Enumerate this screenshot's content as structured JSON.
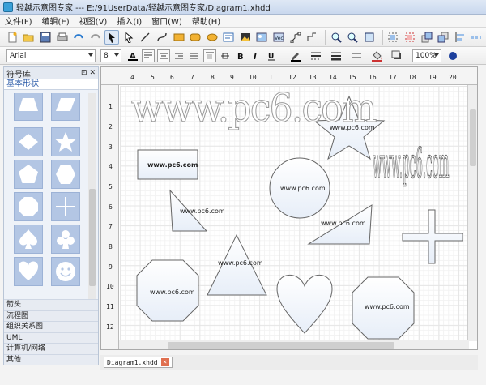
{
  "window": {
    "title": "轻越示意图专家 --- E:/91UserData/轻越示意图专家/Diagram1.xhdd"
  },
  "menu": [
    "文件(F)",
    "编辑(E)",
    "视图(V)",
    "插入(I)",
    "窗口(W)",
    "帮助(H)"
  ],
  "format_bar": {
    "font": "Arial",
    "font_size": "8",
    "zoom": "100%"
  },
  "left_panel": {
    "title": "符号库",
    "category": "基本形状",
    "libraries": [
      "箭头",
      "流程图",
      "组织关系图",
      "UML",
      "计算机/网络",
      "其他"
    ],
    "shapes": [
      "trapezoid",
      "parallelogram",
      "diamond",
      "star",
      "pentagon",
      "hexagon",
      "octagon",
      "cross",
      "spade",
      "club",
      "heart",
      "smiley"
    ]
  },
  "canvas": {
    "ruler_top": [
      "4",
      "5",
      "6",
      "7",
      "8",
      "9",
      "10",
      "11",
      "12",
      "13",
      "14",
      "15",
      "16",
      "17",
      "18",
      "19",
      "20"
    ],
    "ruler_left": [
      "1",
      "2",
      "3",
      "4",
      "5",
      "6",
      "7",
      "8",
      "9",
      "10",
      "11",
      "12"
    ],
    "watermark_large": "www.pc6.com",
    "watermark_vertical": "www.pc6.com",
    "shape_text": "www.pc6.com"
  },
  "doc_tab": {
    "label": "Diagram1.xhdd",
    "close": "×"
  }
}
